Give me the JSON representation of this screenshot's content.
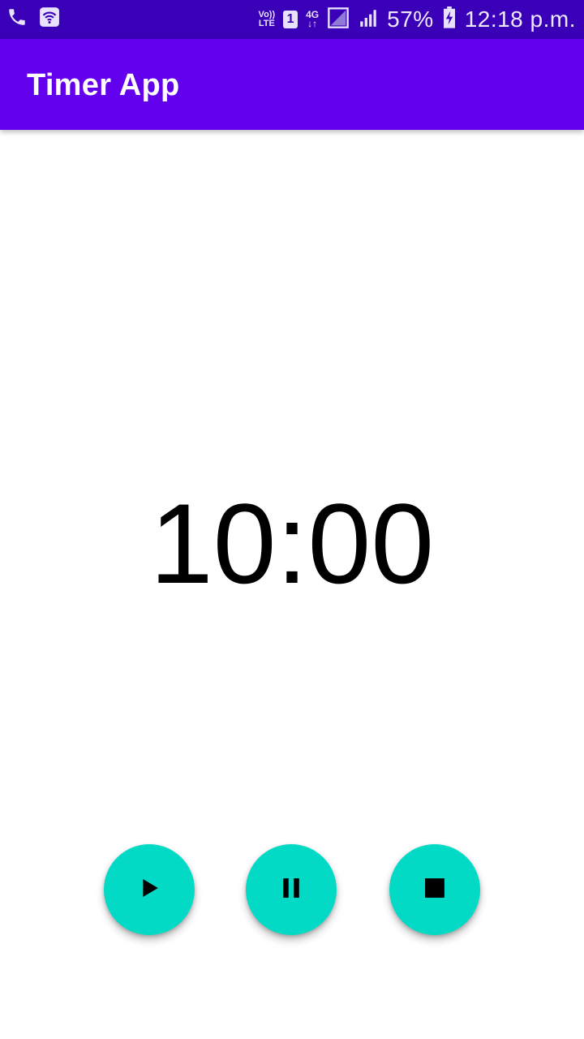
{
  "status_bar": {
    "volte": "Vo))\nLTE",
    "sim": "1",
    "network": "4G",
    "battery_percent": "57%",
    "time": "12:18 p.m.",
    "icons": [
      "phone-icon",
      "wifi-icon",
      "volte-icon",
      "sim-icon",
      "network-4g-icon",
      "signal-empty-icon",
      "signal-icon",
      "battery-charging-icon"
    ]
  },
  "app_bar": {
    "title": "Timer App",
    "color": "#6200ee"
  },
  "timer": {
    "display": "10:00"
  },
  "controls": {
    "accent": "#03dac5",
    "buttons": [
      {
        "icon": "play-icon"
      },
      {
        "icon": "pause-icon"
      },
      {
        "icon": "stop-icon"
      }
    ]
  }
}
